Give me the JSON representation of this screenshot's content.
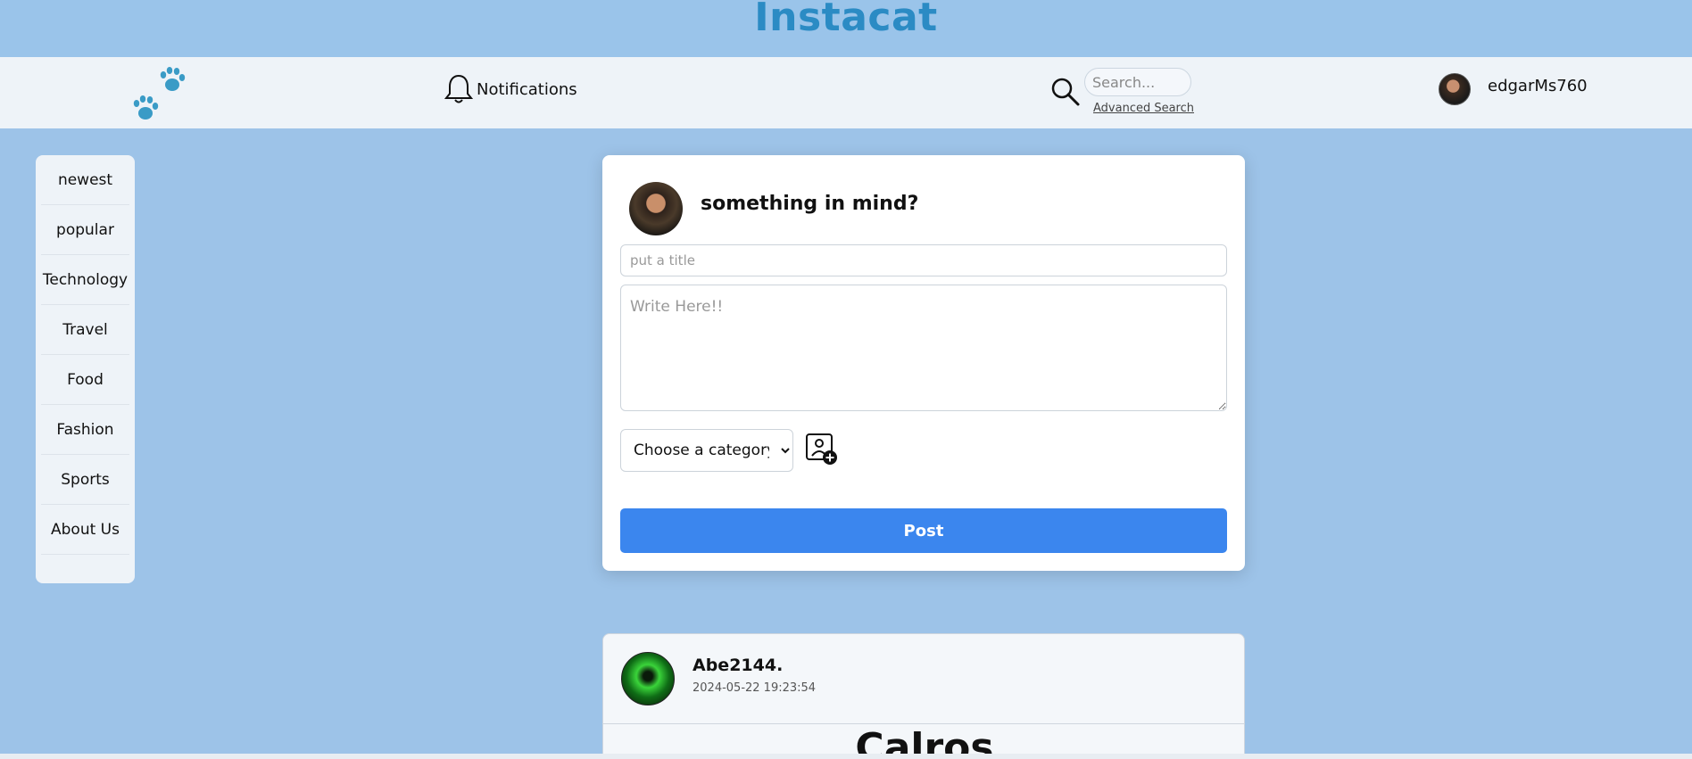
{
  "app": {
    "title": "Instacat"
  },
  "navbar": {
    "notifications_label": "Notifications",
    "search_placeholder": "Search...",
    "advanced_search_label": "Advanced Search",
    "username": "edgarMs760"
  },
  "sidebar": {
    "items": [
      {
        "label": "newest"
      },
      {
        "label": "popular"
      },
      {
        "label": "Technology"
      },
      {
        "label": "Travel"
      },
      {
        "label": "Food"
      },
      {
        "label": "Fashion"
      },
      {
        "label": "Sports"
      },
      {
        "label": "About Us"
      }
    ]
  },
  "compose": {
    "heading": "something in mind?",
    "title_placeholder": "put a title",
    "body_placeholder": "Write Here!!",
    "category_selected": "Choose a category",
    "post_label": "Post"
  },
  "post": {
    "author": "Abe2144.",
    "date": "2024-05-22 19:23:54",
    "title": "Calros"
  },
  "colors": {
    "background": "#9dc3e8",
    "brand": "#2b8bc4",
    "navbar": "#eef3f8",
    "primary_button": "#3b86ee",
    "paw": "#3a9bc6"
  },
  "icons": {
    "logo": "paw-prints-icon",
    "notifications": "bell-icon",
    "search": "magnifier-icon",
    "image_upload": "image-add-icon"
  }
}
